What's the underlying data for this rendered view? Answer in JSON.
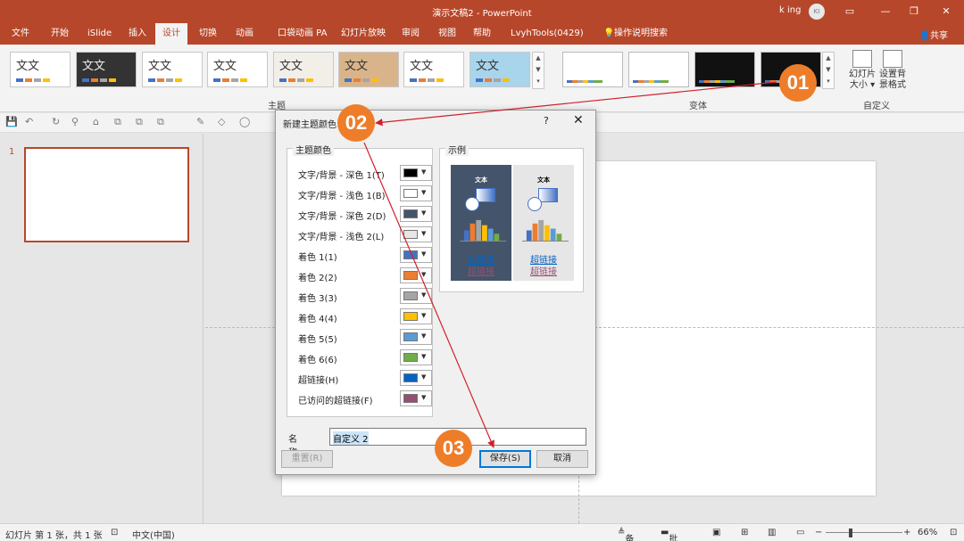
{
  "titlebar": {
    "title": "演示文稿2  -  PowerPoint",
    "user": "k ing",
    "avatar": "KI"
  },
  "tabs": [
    "文件",
    "开始",
    "iSlide",
    "插入",
    "设计",
    "切换",
    "动画",
    "口袋动画 PA",
    "幻灯片放映",
    "审阅",
    "视图",
    "帮助",
    "LvyhTools(0429)",
    "操作说明搜索"
  ],
  "share": "共享",
  "ribbon": {
    "theme_text": "文文",
    "theme_group": "主题",
    "variant_group": "变体",
    "custom_group": "自定义",
    "slide_size": "幻灯片\n大小 ▾",
    "bg_format": "设置背\n景格式"
  },
  "thumbnail": {
    "number": "1"
  },
  "dialog": {
    "title": "新建主题颜色",
    "help": "?",
    "close": "✕",
    "theme_colors_label": "主题颜色",
    "sample_label": "示例",
    "rows": [
      {
        "label": "文字/背景 - 深色 1(T)",
        "color": "#000000"
      },
      {
        "label": "文字/背景 - 浅色 1(B)",
        "color": "#ffffff"
      },
      {
        "label": "文字/背景 - 深色 2(D)",
        "color": "#44546a"
      },
      {
        "label": "文字/背景 - 浅色 2(L)",
        "color": "#e7e6e6"
      },
      {
        "label": "着色 1(1)",
        "color": "#4472c4"
      },
      {
        "label": "着色 2(2)",
        "color": "#ed7d31"
      },
      {
        "label": "着色 3(3)",
        "color": "#a5a5a5"
      },
      {
        "label": "着色 4(4)",
        "color": "#ffc000"
      },
      {
        "label": "着色 5(5)",
        "color": "#5b9bd5"
      },
      {
        "label": "着色 6(6)",
        "color": "#70ad47"
      },
      {
        "label": "超链接(H)",
        "color": "#0563c1"
      },
      {
        "label": "已访问的超链接(F)",
        "color": "#954f72"
      }
    ],
    "sample_text": "文本",
    "hyperlink": "超链接",
    "visited_link": "超链接",
    "name_label": "名称(N):",
    "name_value": "自定义 2",
    "reset": "重置(R)",
    "save": "保存(S)",
    "cancel": "取消"
  },
  "callouts": {
    "c1": "01",
    "c2": "02",
    "c3": "03"
  },
  "status": {
    "slide_info": "幻灯片 第 1 张，共 1 张",
    "language": "中文(中国)",
    "notes": "备注",
    "comments": "批注",
    "zoom": "66%"
  },
  "colors": {
    "accent": "#b7472a",
    "callout": "#ee7d2a",
    "arrow": "#d0202c"
  }
}
